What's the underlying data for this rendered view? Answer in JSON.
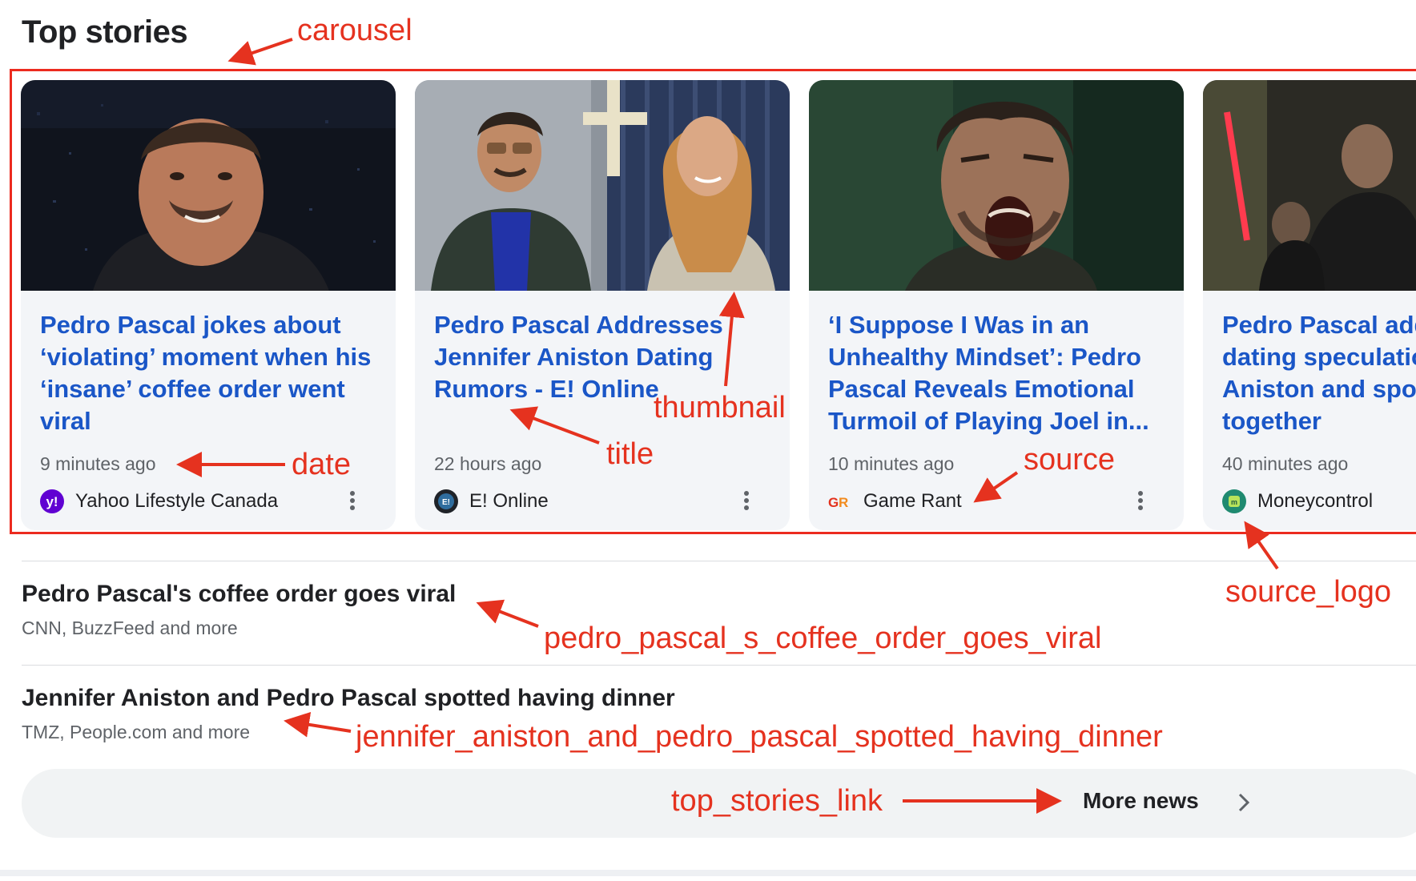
{
  "section_title": "Top stories",
  "cards": [
    {
      "title": "Pedro Pascal jokes about ‘violating’ moment when his ‘insane’ coffee order went viral",
      "date": "9 minutes ago",
      "source": "Yahoo Lifestyle Canada",
      "logo_icon": "yahoo-logo-icon"
    },
    {
      "title": "Pedro Pascal Addresses Jennifer Aniston Dating Rumors - E! Online",
      "date": "22 hours ago",
      "source": "E! Online",
      "logo_icon": "eonline-logo-icon"
    },
    {
      "title": "‘I Suppose I Was in an Unhealthy Mindset’: Pedro Pascal Reveals Emotional Turmoil of Playing Joel in...",
      "date": "10 minutes ago",
      "source": "Game Rant",
      "logo_icon": "gamerant-logo-icon"
    },
    {
      "title": "Pedro Pascal addresses dating speculation: Jennifer Aniston and spotted together",
      "date": "40 minutes ago",
      "source": "Moneycontrol",
      "logo_icon": "moneycontrol-logo-icon"
    }
  ],
  "related": [
    {
      "title": "Pedro Pascal's coffee order goes viral",
      "sources": "CNN, BuzzFeed and more"
    },
    {
      "title": "Jennifer Aniston and Pedro Pascal spotted having dinner",
      "sources": "TMZ, People.com and more"
    }
  ],
  "more_news": {
    "label": "More news",
    "icon": "chevron-right-icon"
  },
  "annotations": {
    "carousel": "carousel",
    "date": "date",
    "title": "title",
    "thumbnail": "thumbnail",
    "source": "source",
    "source_logo": "source_logo",
    "related_1": "pedro_pascal_s_coffee_order_goes_viral",
    "related_2": "jennifer_aniston_and_pedro_pascal_spotted_having_dinner",
    "top_stories_link": "top_stories_link"
  },
  "colors": {
    "annotation": "#e5321f",
    "link": "#1a56c7",
    "brand_yahoo": "#6001d2",
    "brand_moneycontrol": "#1f8a70"
  }
}
